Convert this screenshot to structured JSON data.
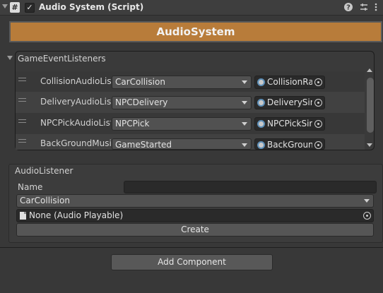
{
  "header": {
    "component_title": "Audio System (Script)",
    "script_icon": "script-hash-icon",
    "enabled_check": "✓",
    "help_icon": "?",
    "settings_icon": "⇅",
    "menu_icon": "⋮"
  },
  "banner": {
    "title": "AudioSystem",
    "color": "#b87c3a"
  },
  "listeners": {
    "title": "GameEventListeners",
    "rows": [
      {
        "label": "CollisionAudioListener",
        "event": "CarCollision",
        "target": "CollisionRa"
      },
      {
        "label": "DeliveryAudioListener",
        "event": "NPCDelivery",
        "target": "DeliverySin"
      },
      {
        "label": "NPCPickAudioListener",
        "event": "NPCPick",
        "target": "NPCPickSir"
      },
      {
        "label": "BackGroundMusicListener",
        "event": "GameStarted",
        "target": "BackGroun"
      }
    ]
  },
  "audio_listener": {
    "title": "AudioListener",
    "name_label": "Name",
    "name_value": "",
    "event_selected": "CarCollision",
    "playable_value": "None (Audio Playable)",
    "create_label": "Create"
  },
  "footer": {
    "add_component_label": "Add Component"
  }
}
